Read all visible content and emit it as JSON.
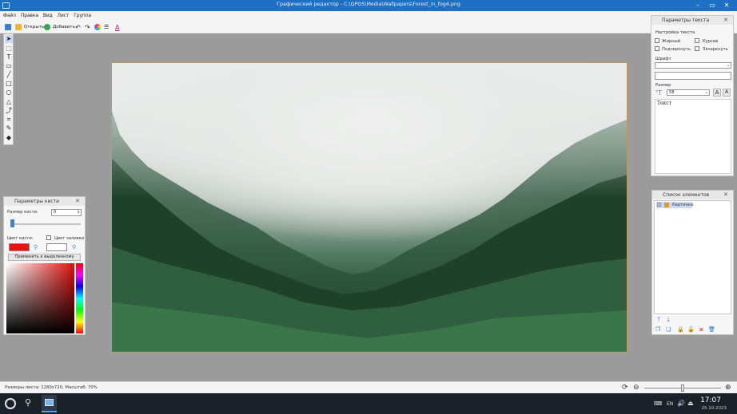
{
  "window": {
    "title": "Графический редактор - C:\\QPOS\\Media\\Wallpapers\\Forest_in_fog4.png",
    "controls": [
      "–",
      "▭",
      "✕"
    ]
  },
  "menu": {
    "items": [
      "Файл",
      "Правка",
      "Вид",
      "Лист",
      "Группа"
    ]
  },
  "toolbar": {
    "open_label": "Открыть",
    "add_label": "Добавить"
  },
  "text_panel": {
    "title": "Параметры текста",
    "section_label": "Настройка текста",
    "bold_label": "Жирный",
    "italic_label": "Курсив",
    "underline_label": "Подчеркнуть",
    "strike_label": "Зачеркнуть",
    "font_label": "Шрифт",
    "font_value": "",
    "size_label": "Размер",
    "size_value": "58",
    "text_value": "Текст"
  },
  "brush_panel": {
    "title": "Параметры кисти",
    "size_label": "Размер кисти:",
    "size_value": "0",
    "color_label": "Цвет кисти:",
    "fill_label": "Цвет заливки",
    "apply_label": "Применить к выделенному",
    "brush_color": "#ee1111",
    "fill_color": "#ffffff"
  },
  "elements_panel": {
    "title": "Список элементов",
    "items": [
      "Картинка"
    ]
  },
  "status": {
    "text": "Размеры листа: 1280x720, Масштаб: 70%",
    "zoom_fraction": 0.5
  },
  "taskbar": {
    "lang": "EN",
    "time": "17:07",
    "date": "25.10.2023"
  },
  "colors": {
    "titlebar": "#1f6fc4",
    "taskbar": "#1a2128",
    "workspace": "#9b9b9b",
    "selection": "#c9daf2"
  }
}
